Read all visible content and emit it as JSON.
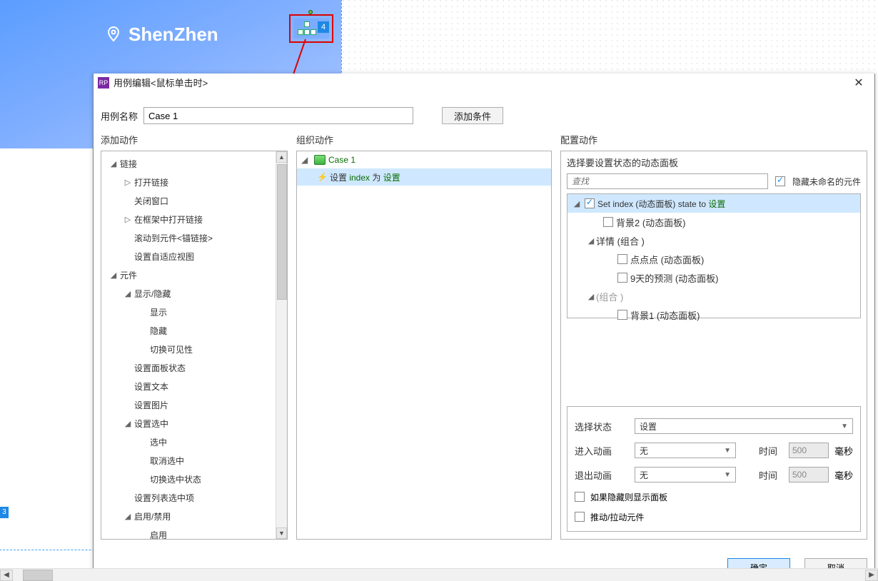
{
  "banner": {
    "city": "ShenZhen",
    "sel_count": "4",
    "page_handle": "3"
  },
  "dialog": {
    "title": "用例编辑<鼠标单击时>",
    "case_label": "用例名称",
    "case_name": "Case 1",
    "add_condition": "添加条件",
    "col_add_action": "添加动作",
    "col_org_action": "组织动作",
    "col_cfg_action": "配置动作",
    "ok": "确定",
    "cancel": "取消"
  },
  "left_tree": {
    "n0": "链接",
    "n0_0": "打开链接",
    "n0_1": "关闭窗口",
    "n0_2": "在框架中打开链接",
    "n0_3": "滚动到元件<锚链接>",
    "n0_4": "设置自适应视图",
    "n1": "元件",
    "n1_0": "显示/隐藏",
    "n1_0_0": "显示",
    "n1_0_1": "隐藏",
    "n1_0_2": "切换可见性",
    "n1_1": "设置面板状态",
    "n1_2": "设置文本",
    "n1_3": "设置图片",
    "n1_4": "设置选中",
    "n1_4_0": "选中",
    "n1_4_1": "取消选中",
    "n1_4_2": "切换选中状态",
    "n1_5": "设置列表选中项",
    "n1_6": "启用/禁用",
    "n1_6_0": "启用"
  },
  "mid": {
    "case": "Case 1",
    "action": {
      "pre": "设置 ",
      "k1": "index",
      "mid": " 为 ",
      "k2": "设置"
    }
  },
  "right": {
    "head": "选择要设置状态的动态面板",
    "search_placeholder": "查找",
    "hide_unnamed": "隐藏未命名的元件",
    "tree": {
      "r0_pre": "Set ",
      "r0_name": "index (动态面板)",
      "r0_mid": " state to ",
      "r0_val": "设置",
      "r1": "背景2 (动态面板)",
      "r2": "详情 (组合 )",
      "r3": "点点点 (动态面板)",
      "r4": "9天的预测 (动态面板)",
      "r5": "(组合 )",
      "r6": "背景1 (动态面板)"
    },
    "prop": {
      "state_lbl": "选择状态",
      "state_val": "设置",
      "anim_in_lbl": "进入动画",
      "anim_val": "无",
      "time_lbl": "时间",
      "time_val": "500",
      "ms": "毫秒",
      "anim_out_lbl": "退出动画",
      "show_if_hidden": "如果隐藏则显示面板",
      "push_pull": "推动/拉动元件"
    }
  }
}
